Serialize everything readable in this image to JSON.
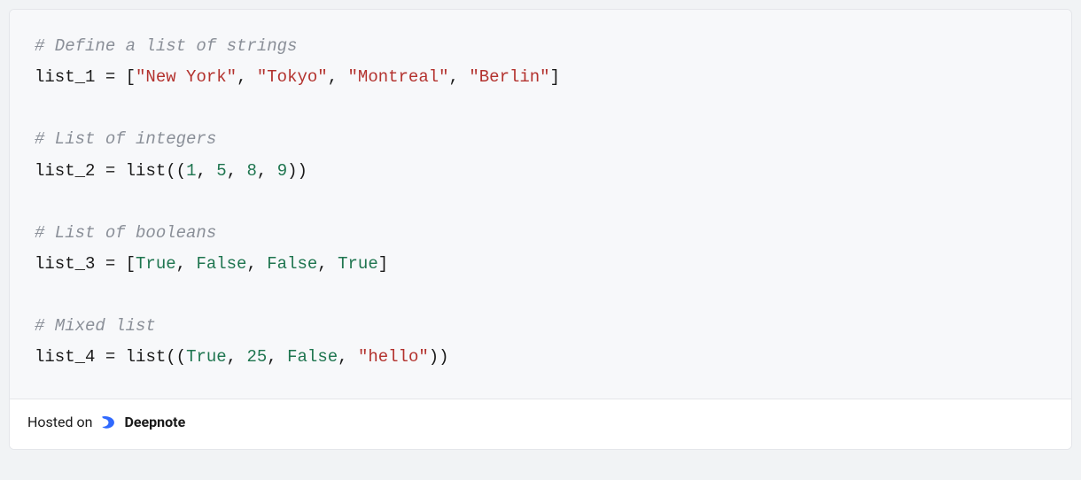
{
  "code": {
    "lines": [
      {
        "type": "comment",
        "text": "# Define a list of strings"
      },
      {
        "type": "assign_list_str",
        "var": "list_1",
        "values": [
          "New York",
          "Tokyo",
          "Montreal",
          "Berlin"
        ]
      },
      {
        "type": "blank"
      },
      {
        "type": "comment",
        "text": "# List of integers"
      },
      {
        "type": "assign_list_call_num",
        "var": "list_2",
        "func": "list",
        "values": [
          1,
          5,
          8,
          9
        ]
      },
      {
        "type": "blank"
      },
      {
        "type": "comment",
        "text": "# List of booleans"
      },
      {
        "type": "assign_list_bool",
        "var": "list_3",
        "values": [
          "True",
          "False",
          "False",
          "True"
        ]
      },
      {
        "type": "blank"
      },
      {
        "type": "comment",
        "text": "# Mixed list"
      },
      {
        "type": "assign_list_call_mixed",
        "var": "list_4",
        "func": "list",
        "values": [
          {
            "kind": "bool",
            "v": "True"
          },
          {
            "kind": "num",
            "v": 25
          },
          {
            "kind": "bool",
            "v": "False"
          },
          {
            "kind": "str",
            "v": "hello"
          }
        ]
      }
    ]
  },
  "footer": {
    "hosted_on": "Hosted on",
    "brand": "Deepnote"
  },
  "colors": {
    "comment": "#8a8f98",
    "string": "#b3322e",
    "number": "#1e754f",
    "brand": "#3069fe"
  }
}
